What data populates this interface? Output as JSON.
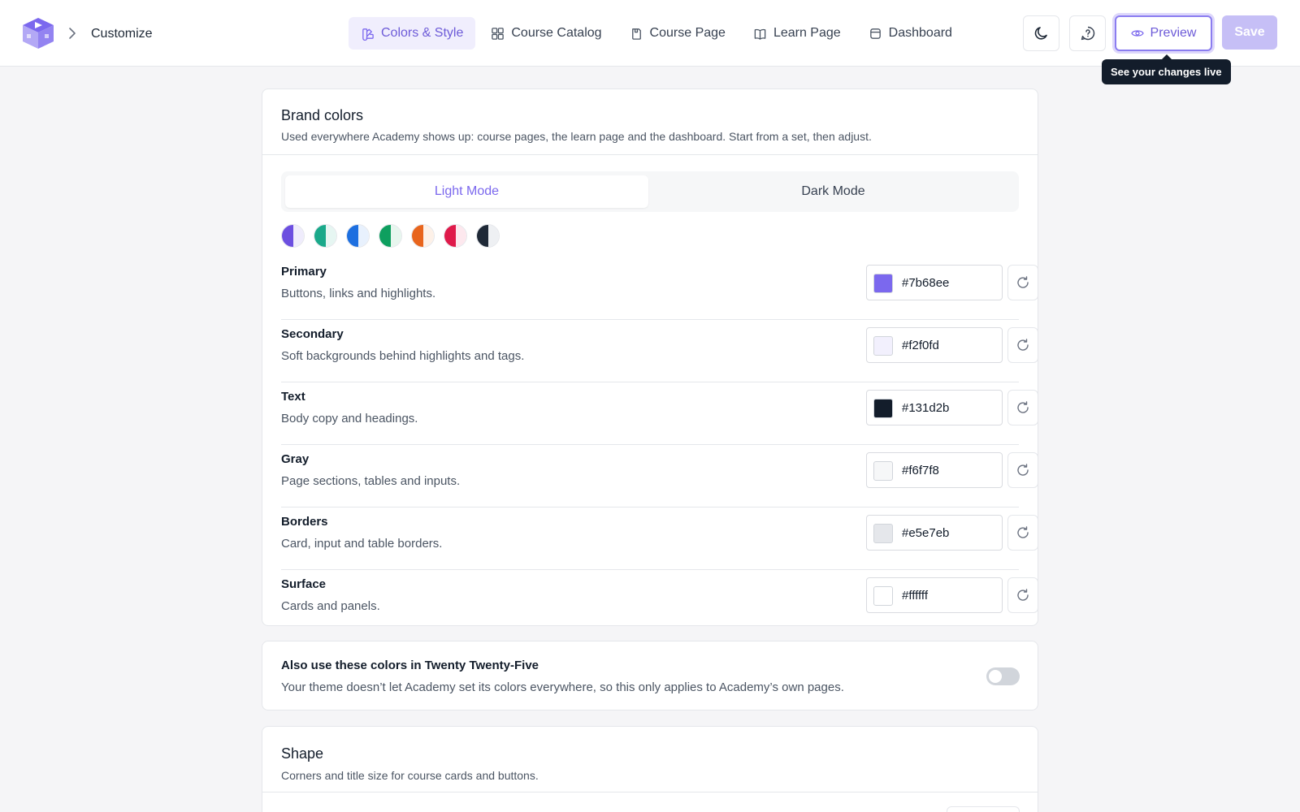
{
  "app": {
    "breadcrumb": "Customize",
    "logo_icon": "graduation-cap-play-icon",
    "accent": "#7b68ee"
  },
  "nav": {
    "tabs": [
      {
        "label": "Colors & Style",
        "icon": "palette-icon",
        "active": true
      },
      {
        "label": "Course Catalog",
        "icon": "grid-icon",
        "active": false
      },
      {
        "label": "Course Page",
        "icon": "page-icon",
        "active": false
      },
      {
        "label": "Learn Page",
        "icon": "book-icon",
        "active": false
      },
      {
        "label": "Dashboard",
        "icon": "dashboard-icon",
        "active": false
      }
    ]
  },
  "toolbar": {
    "dark_mode_icon": "moon-icon",
    "help_icon": "help-bubble-icon",
    "preview_label": "Preview",
    "preview_icon": "eye-icon",
    "save_label": "Save",
    "tooltip": "See your changes live"
  },
  "brand_colors": {
    "title": "Brand colors",
    "description": "Used everywhere Academy shows up: course pages, the learn page and the dashboard. Start from a set, then adjust.",
    "modes": {
      "light": "Light Mode",
      "dark": "Dark Mode",
      "selected": "light"
    },
    "presets": [
      {
        "left": "#6c4fe0",
        "right": "#efecfc"
      },
      {
        "left": "#1aa98a",
        "right": "#e6f6f2"
      },
      {
        "left": "#1d6fe0",
        "right": "#e8f1fd"
      },
      {
        "left": "#0e9f5f",
        "right": "#e7f6ee"
      },
      {
        "left": "#e8651d",
        "right": "#fdf1e8"
      },
      {
        "left": "#df1a4a",
        "right": "#fde8ee"
      },
      {
        "left": "#1f2937",
        "right": "#eef0f3"
      }
    ],
    "rows": [
      {
        "label": "Primary",
        "description": "Buttons, links and highlights.",
        "hex": "#7b68ee"
      },
      {
        "label": "Secondary",
        "description": "Soft backgrounds behind highlights and tags.",
        "hex": "#f2f0fd"
      },
      {
        "label": "Text",
        "description": "Body copy and headings.",
        "hex": "#131d2b"
      },
      {
        "label": "Gray",
        "description": "Page sections, tables and inputs.",
        "hex": "#f6f7f8"
      },
      {
        "label": "Borders",
        "description": "Card, input and table borders.",
        "hex": "#e5e7eb"
      },
      {
        "label": "Surface",
        "description": "Cards and panels.",
        "hex": "#ffffff"
      }
    ],
    "reset_icon": "reset-icon"
  },
  "theme_sync": {
    "title": "Also use these colors in Twenty Twenty-Five",
    "description": "Your theme doesn’t let Academy set its colors everywhere, so this only applies to Academy’s own pages.",
    "enabled": false
  },
  "shape": {
    "title": "Shape",
    "description": "Corners and title size for course cards and buttons."
  }
}
